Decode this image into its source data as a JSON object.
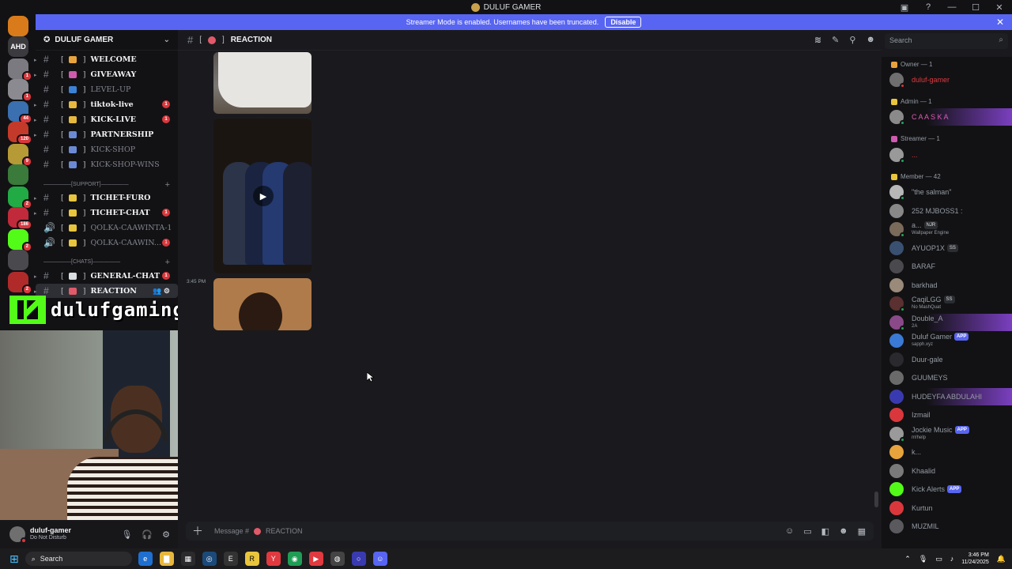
{
  "window": {
    "title": "DULUF GAMER",
    "controls": [
      "inbox-icon",
      "help-icon",
      "minimize-icon",
      "maximize-icon",
      "close-icon"
    ]
  },
  "banner": {
    "text": "Streamer Mode is enabled. Usernames have been truncated.",
    "button": "Disable"
  },
  "guilds": [
    {
      "label": "",
      "color": "#d97b1a",
      "badge": ""
    },
    {
      "label": "AHD",
      "color": "#3a3a3f",
      "badge": ""
    },
    {
      "label": "",
      "color": "#7a7a80",
      "badge": "1"
    },
    {
      "label": "",
      "color": "#8a8a90",
      "badge": "1"
    },
    {
      "label": "",
      "color": "#3a6fb0",
      "badge": "44"
    },
    {
      "label": "",
      "color": "#c43a2a",
      "badge": "120"
    },
    {
      "label": "",
      "color": "#b59a35",
      "badge": "9"
    },
    {
      "label": "",
      "color": "#3a7a3a",
      "badge": ""
    },
    {
      "label": "",
      "color": "#22aa44",
      "badge": "2"
    },
    {
      "label": "",
      "color": "#c02a3a",
      "badge": "186"
    },
    {
      "label": "",
      "color": "#53fc18",
      "badge": "2"
    },
    {
      "label": "",
      "color": "#4a4a4e",
      "badge": ""
    },
    {
      "label": "",
      "color": "#b02a2a",
      "badge": "2"
    }
  ],
  "server": {
    "name": "DULUF GAMER"
  },
  "channels": [
    {
      "name": "WELCOME",
      "type": "text",
      "emoji_color": "#e8a33d",
      "badge": "",
      "muted": false
    },
    {
      "name": "GIVEAWAY",
      "type": "text",
      "emoji_color": "#d05ab0",
      "badge": "",
      "muted": false
    },
    {
      "name": "LEVEL-UP",
      "type": "text",
      "emoji_color": "#3b82d6",
      "badge": "",
      "muted": true
    },
    {
      "name": "tiktok-live",
      "type": "text",
      "emoji_color": "#e8b83d",
      "badge": "1",
      "muted": false
    },
    {
      "name": "KICK-LIVE",
      "type": "text",
      "emoji_color": "#e8b83d",
      "badge": "1",
      "muted": false
    },
    {
      "name": "PARTNERSHIP",
      "type": "text",
      "emoji_color": "#6b8ad6",
      "badge": "",
      "muted": false
    },
    {
      "name": "KICK-SHOP",
      "type": "text",
      "emoji_color": "#6b8ad6",
      "badge": "",
      "muted": true
    },
    {
      "name": "KICK-SHOP-WINS",
      "type": "text",
      "emoji_color": "#6b8ad6",
      "badge": "",
      "muted": true
    }
  ],
  "category_support": "[SUPPORT]",
  "support_channels": [
    {
      "name": "TICHET-FURO",
      "type": "text",
      "emoji_color": "#e8c53d",
      "badge": "",
      "muted": false
    },
    {
      "name": "TICHET-CHAT",
      "type": "text",
      "emoji_color": "#e8c53d",
      "badge": "1",
      "muted": false
    },
    {
      "name": "QOLKA-CAAWINTA-1",
      "type": "voice",
      "emoji_color": "#e8c53d",
      "badge": "",
      "muted": true
    },
    {
      "name": "QOLKA-CAAWIN...",
      "type": "voice",
      "emoji_color": "#e8c53d",
      "badge": "1",
      "muted": true
    }
  ],
  "category_chats": "[CHATS]",
  "chat_channels": [
    {
      "name": "GENERAL-CHAT",
      "type": "text",
      "emoji_color": "#dbdee1",
      "badge": "1",
      "muted": false
    },
    {
      "name": "REACTION",
      "type": "text",
      "emoji_color": "#e05a6a",
      "badge": "",
      "muted": false
    }
  ],
  "overlay": {
    "streamer_name": "dulufgaming"
  },
  "header": {
    "channel": "REACTION"
  },
  "search": {
    "placeholder": "Search"
  },
  "messages": {
    "timestamp": "3:45 PM"
  },
  "members": {
    "groups": [
      {
        "title": "Owner — 1",
        "icon_color": "#e8a33d"
      },
      {
        "title": "Admin — 1",
        "icon_color": "#e8c53d"
      },
      {
        "title": "Streamer — 1",
        "icon_color": "#d05ab0"
      },
      {
        "title": "Member — 42",
        "icon_color": "#e8c53d"
      }
    ],
    "owner": [
      {
        "name": "duluf-gamer",
        "color": "#e0393f",
        "sub": "",
        "av": "#6f6f6f",
        "status": "#da373c"
      }
    ],
    "admin": [
      {
        "name": "C A A S K A",
        "color": "#e05ab5",
        "sub": "",
        "av": "#8a8a8a",
        "status": "#23a55a"
      }
    ],
    "streamer": [
      {
        "name": "...",
        "color": "#e0393f",
        "sub": "",
        "av": "#999999",
        "status": "#23a55a"
      }
    ],
    "member": [
      {
        "name": "\"the salman\"",
        "color": "#949ba4",
        "sub": "",
        "av": "#b7b7b7",
        "status": "#23a55a",
        "tag": ""
      },
      {
        "name": "252 MJBOSS1 :",
        "color": "#949ba4",
        "sub": "",
        "av": "#888888",
        "status": "",
        "tag": ""
      },
      {
        "name": "a...",
        "color": "#949ba4",
        "sub": "Wallpaper Engine",
        "av": "#7a6a5a",
        "status": "#23a55a",
        "tag": "NJR"
      },
      {
        "name": "AYUOP1X",
        "color": "#949ba4",
        "sub": "",
        "av": "#3a5070",
        "status": "",
        "tag": "SS"
      },
      {
        "name": "BARAF",
        "color": "#949ba4",
        "sub": "",
        "av": "#4a4a4e",
        "status": "",
        "tag": ""
      },
      {
        "name": "barkhad",
        "color": "#949ba4",
        "sub": "",
        "av": "#9a8a7a",
        "status": "",
        "tag": ""
      },
      {
        "name": "CaqiLGG",
        "color": "#949ba4",
        "sub": "No MashQuat",
        "av": "#5a3030",
        "status": "#23a55a",
        "tag": "SS"
      },
      {
        "name": "Double_A",
        "color": "#949ba4",
        "sub": "2A",
        "av": "#8a4a8a",
        "status": "#23a55a",
        "tag": ""
      },
      {
        "name": "Duluf Gamer",
        "color": "#949ba4",
        "sub": "sapph.xyz",
        "av": "#3a7ad6",
        "status": "",
        "tag": "",
        "app": "APP"
      },
      {
        "name": "Duur-gale",
        "color": "#949ba4",
        "sub": "",
        "av": "#2a2a2e",
        "status": "",
        "tag": ""
      },
      {
        "name": "GUUMEYS",
        "color": "#949ba4",
        "sub": "",
        "av": "#6a6a6a",
        "status": "",
        "tag": ""
      },
      {
        "name": "HUDEYFA ABDULAHI",
        "color": "#949ba4",
        "sub": "",
        "av": "#3a3ab0",
        "status": "",
        "tag": ""
      },
      {
        "name": "Izmail",
        "color": "#949ba4",
        "sub": "",
        "av": "#da373c",
        "status": "",
        "tag": ""
      },
      {
        "name": "Jockie Music",
        "color": "#949ba4",
        "sub": "m!help",
        "av": "#9a9a9a",
        "status": "#23a55a",
        "tag": "",
        "app": "APP"
      },
      {
        "name": "k...",
        "color": "#949ba4",
        "sub": "",
        "av": "#e8a33d",
        "status": "",
        "tag": ""
      },
      {
        "name": "Khaalid",
        "color": "#949ba4",
        "sub": "",
        "av": "#7a7a7a",
        "status": "",
        "tag": ""
      },
      {
        "name": "Kick Alerts",
        "color": "#949ba4",
        "sub": "",
        "av": "#53fc18",
        "status": "",
        "tag": "",
        "app": "APP"
      },
      {
        "name": "Kurtun",
        "color": "#949ba4",
        "sub": "",
        "av": "#da373c",
        "status": "",
        "tag": ""
      },
      {
        "name": "MUZMIL",
        "color": "#949ba4",
        "sub": "",
        "av": "#5a5a5e",
        "status": "",
        "tag": ""
      }
    ]
  },
  "user": {
    "name": "duluf-gamer",
    "status": "Do Not Disturb"
  },
  "composer": {
    "placeholder": "Message #",
    "channel": "REACTION"
  },
  "taskbar": {
    "search": "Search",
    "time": "3:46 PM",
    "date": "11/24/2025"
  }
}
